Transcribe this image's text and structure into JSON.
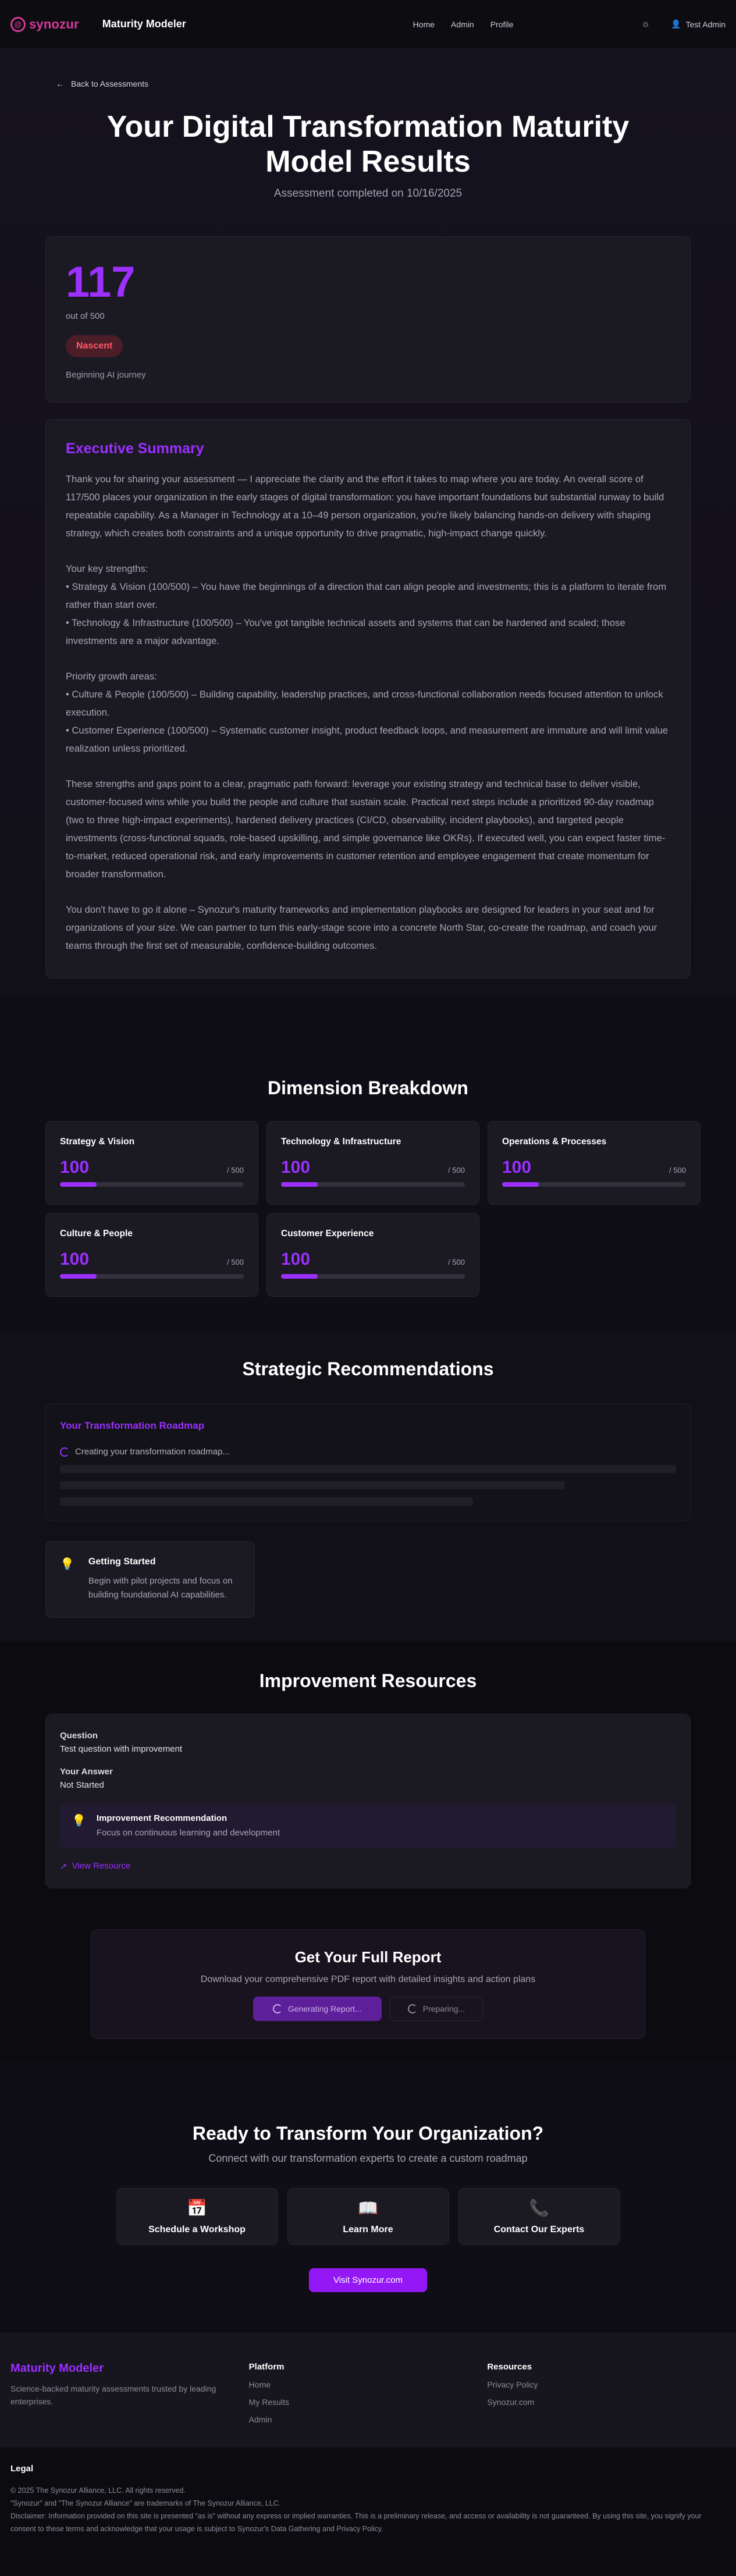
{
  "header": {
    "logo_text": "synozur",
    "app_title": "Maturity Modeler",
    "nav": [
      "Home",
      "Admin",
      "Profile"
    ],
    "user": "Test Admin"
  },
  "hero": {
    "back": "Back to Assessments",
    "title": "Your Digital Transformation Maturity Model Results",
    "subtitle": "Assessment completed on 10/16/2025"
  },
  "score": {
    "value": "117",
    "out_of": "out of 500",
    "level": "Nascent",
    "journey": "Beginning AI journey"
  },
  "summary": {
    "title": "Executive Summary",
    "paragraphs": [
      "Thank you for sharing your assessment — I appreciate the clarity and the effort it takes to map where you are today. An overall score of 117/500 places your organization in the early stages of digital transformation: you have important foundations but substantial runway to build repeatable capability. As a Manager in Technology at a 10–49 person organization, you're likely balancing hands-on delivery with shaping strategy, which creates both constraints and a unique opportunity to drive pragmatic, high-impact change quickly.",
      "Your key strengths:\n• Strategy & Vision (100/500) – You have the beginnings of a direction that can align people and investments; this is a platform to iterate from rather than start over.\n• Technology & Infrastructure (100/500) – You've got tangible technical assets and systems that can be hardened and scaled; those investments are a major advantage.",
      "Priority growth areas:\n• Culture & People (100/500) – Building capability, leadership practices, and cross-functional collaboration needs focused attention to unlock execution.\n• Customer Experience (100/500) – Systematic customer insight, product feedback loops, and measurement are immature and will limit value realization unless prioritized.",
      "These strengths and gaps point to a clear, pragmatic path forward: leverage your existing strategy and technical base to deliver visible, customer-focused wins while you build the people and culture that sustain scale. Practical next steps include a prioritized 90-day roadmap (two to three high-impact experiments), hardened delivery practices (CI/CD, observability, incident playbooks), and targeted people investments (cross-functional squads, role-based upskilling, and simple governance like OKRs). If executed well, you can expect faster time-to-market, reduced operational risk, and early improvements in customer retention and employee engagement that create momentum for broader transformation.",
      "You don't have to go it alone – Synozur's maturity frameworks and implementation playbooks are designed for leaders in your seat and for organizations of your size. We can partner to turn this early-stage score into a concrete North Star, co-create the roadmap, and coach your teams through the first set of measurable, confidence-building outcomes."
    ]
  },
  "dimensions": {
    "title": "Dimension Breakdown",
    "items": [
      {
        "name": "Strategy & Vision",
        "score": "100",
        "max": "/ 500",
        "fraction": 0.2
      },
      {
        "name": "Technology & Infrastructure",
        "score": "100",
        "max": "/ 500",
        "fraction": 0.2
      },
      {
        "name": "Operations & Processes",
        "score": "100",
        "max": "/ 500",
        "fraction": 0.2
      },
      {
        "name": "Culture & People",
        "score": "100",
        "max": "/ 500",
        "fraction": 0.2
      },
      {
        "name": "Customer Experience",
        "score": "100",
        "max": "/ 500",
        "fraction": 0.2
      }
    ]
  },
  "recommendations": {
    "title": "Strategic Recommendations",
    "roadmap_title": "Your Transformation Roadmap",
    "roadmap_loading": "Creating your transformation roadmap...",
    "getting_started_title": "Getting Started",
    "getting_started_text": "Begin with pilot projects and focus on building foundational AI capabilities."
  },
  "resources": {
    "title": "Improvement Resources",
    "question_label": "Question",
    "question": "Test question with improvement",
    "answer_label": "Your Answer",
    "answer": "Not Started",
    "rec_title": "Improvement Recommendation",
    "rec_text": "Focus on continuous learning and development",
    "view": "View Resource"
  },
  "report": {
    "title": "Get Your Full Report",
    "subtitle": "Download your comprehensive PDF report with detailed insights and action plans",
    "generating": "Generating Report...",
    "preparing": "Preparing..."
  },
  "cta": {
    "title": "Ready to Transform Your Organization?",
    "subtitle": "Connect with our transformation experts to create a custom roadmap",
    "items": [
      "Schedule a Workshop",
      "Learn More",
      "Contact Our Experts"
    ],
    "visit": "Visit Synozur.com"
  },
  "footer": {
    "brand": "Maturity Modeler",
    "desc": "Science-backed maturity assessments trusted by leading enterprises.",
    "platform_head": "Platform",
    "platform": [
      "Home",
      "My Results",
      "Admin"
    ],
    "resources_head": "Resources",
    "resources": [
      "Privacy Policy",
      "Synozur.com"
    ]
  },
  "legal": {
    "title": "Legal",
    "copyright": "© 2025 The Synozur Alliance, LLC. All rights reserved.",
    "trademark": "\"Synozur\" and \"The Synozur Alliance\" are trademarks of The Synozur Alliance, LLC.",
    "disclaimer": "Disclaimer: Information provided on this site is presented \"as is\" without any express or implied warranties. This is a preliminary release, and access or availability is not guaranteed. By using this site, you signify your consent to these terms and acknowledge that your usage is subject to Synozur's Data Gathering and Privacy Policy."
  }
}
